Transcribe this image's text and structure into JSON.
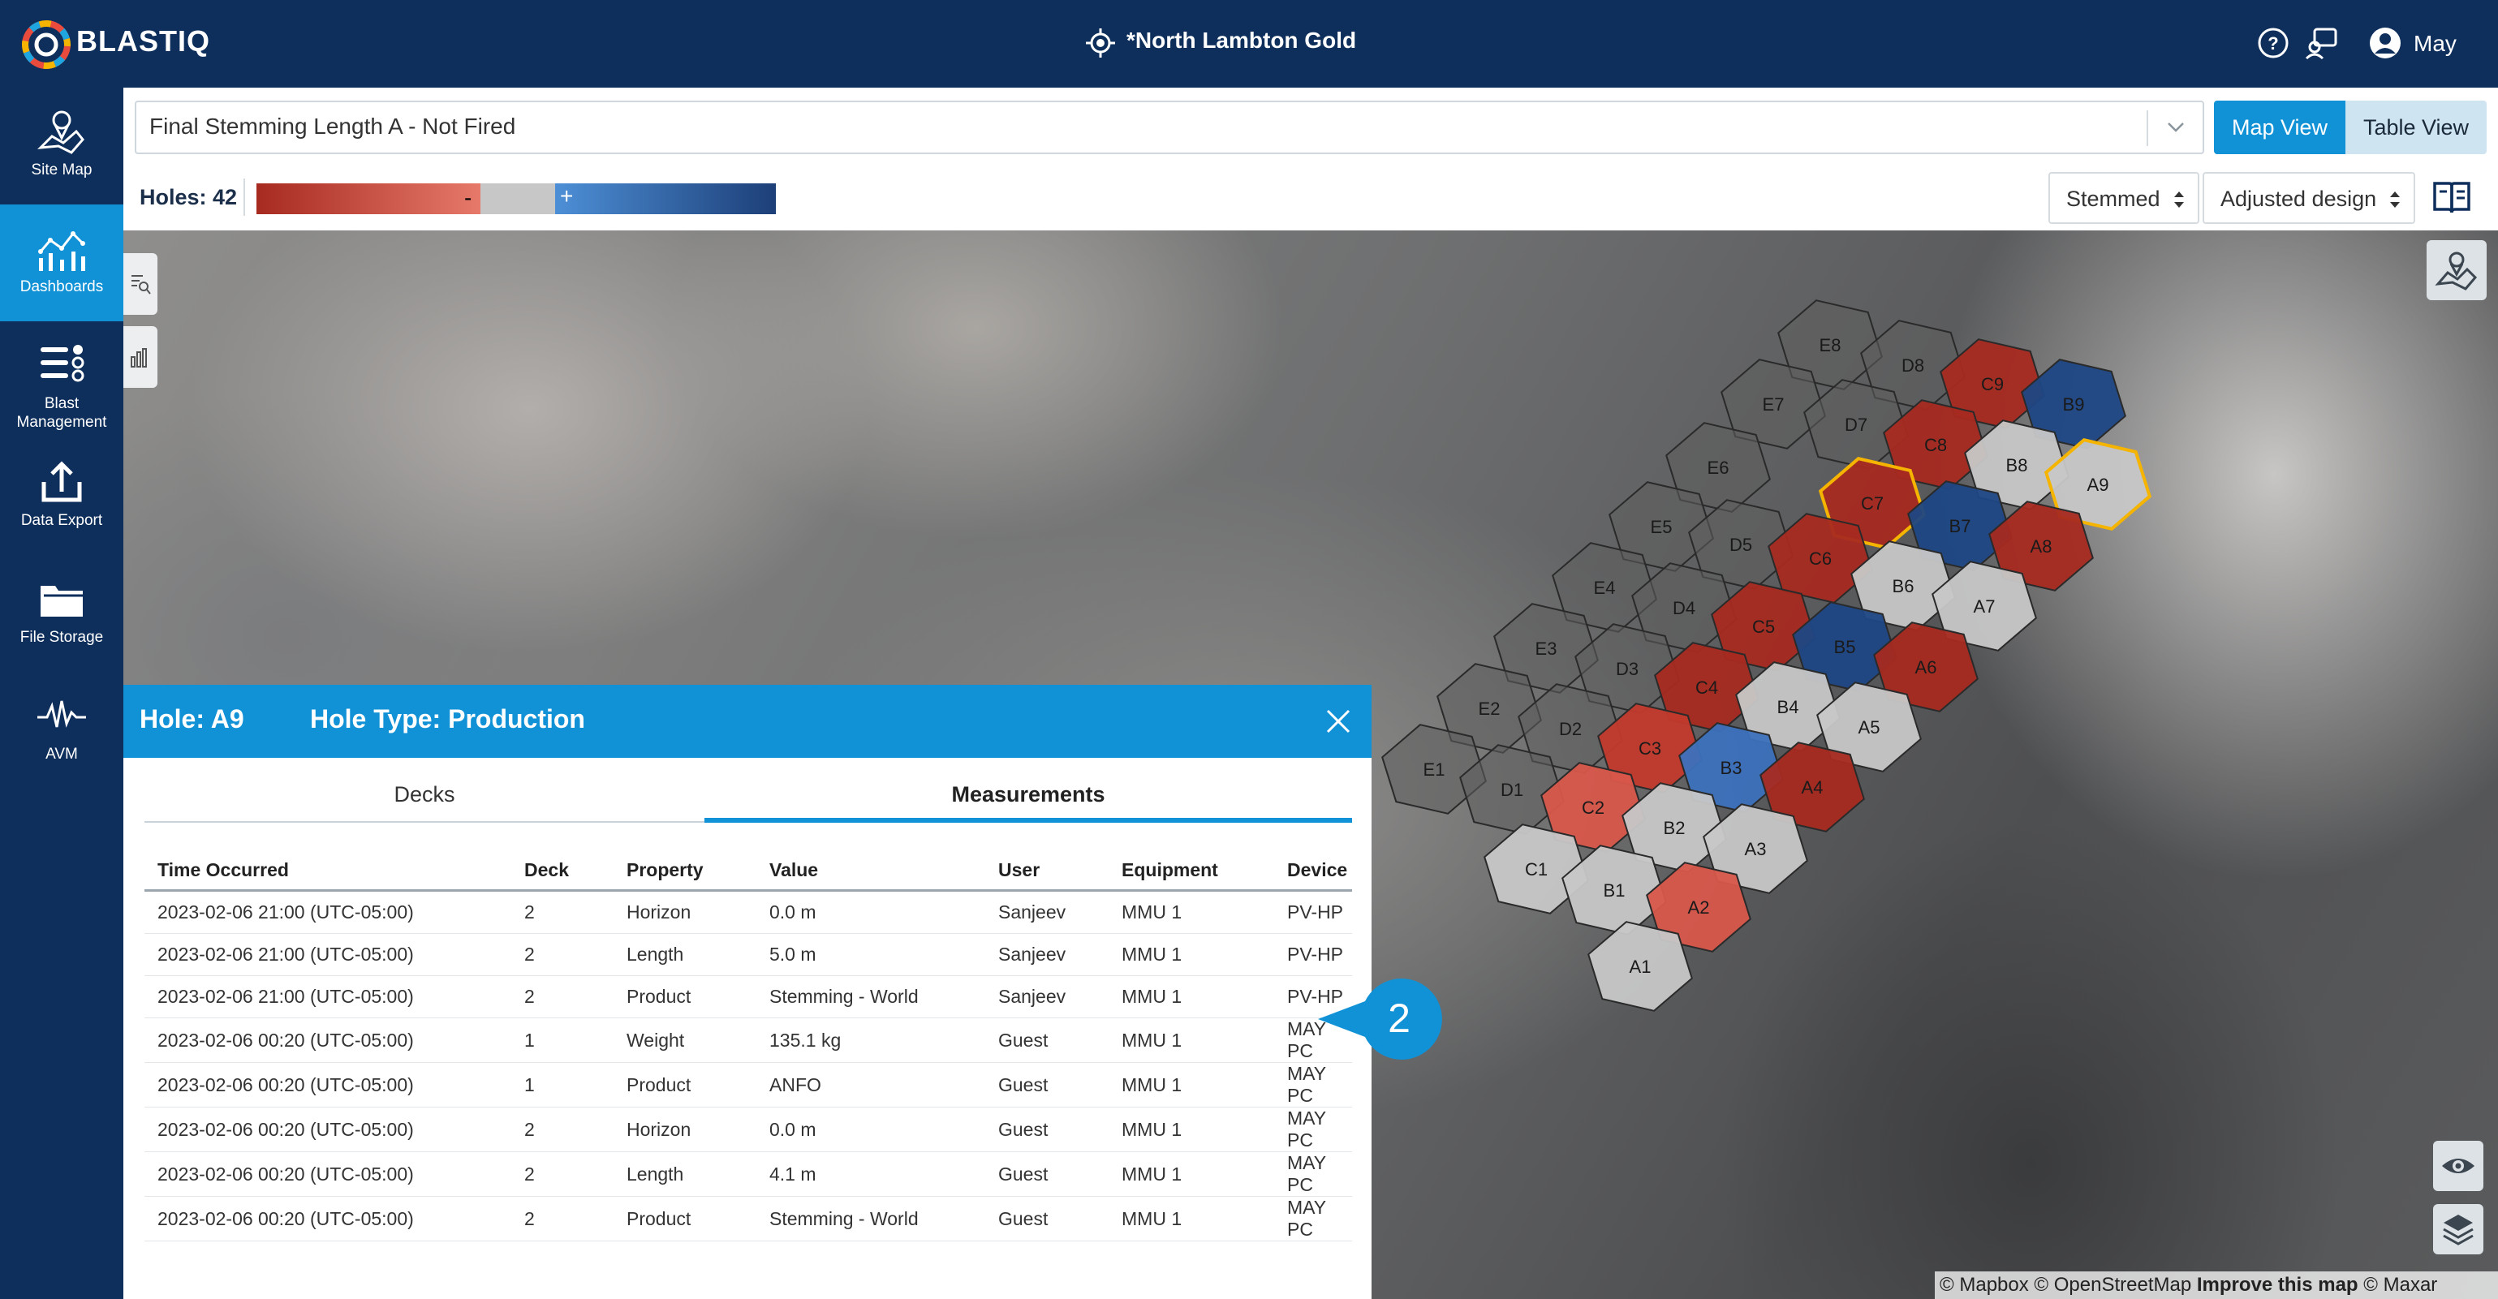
{
  "app": {
    "brand": "BLASTIQ",
    "site_name": "*North Lambton Gold",
    "user_name": "May"
  },
  "sidebar": {
    "items": [
      {
        "label": "Site Map",
        "icon": "site-map-icon"
      },
      {
        "label": "Dashboards",
        "icon": "dashboards-icon",
        "active": true
      },
      {
        "label": "Blast Management",
        "icon": "blast-management-icon"
      },
      {
        "label": "Data Export",
        "icon": "data-export-icon"
      },
      {
        "label": "File Storage",
        "icon": "file-storage-icon"
      },
      {
        "label": "AVM",
        "icon": "avm-icon"
      }
    ]
  },
  "toolbar": {
    "metric": "Final Stemming Length A - Not Fired",
    "view_map": "Map View",
    "view_table": "Table View",
    "active_view": "Map View",
    "holes_label": "Holes: 42",
    "legend_minus": "-",
    "legend_plus": "+",
    "filter_stemmed": "Stemmed",
    "filter_design": "Adjusted design"
  },
  "colors": {
    "navy": "#0e2f5c",
    "accent": "#1292d6",
    "dark_red": "#a72a20",
    "mid_red": "#c23a2c",
    "light_red": "#d9574b",
    "grey": "#c7c7c7",
    "light_blue": "#3c71bd",
    "dark_blue": "#1d4784",
    "unknown": "#5f5f5f",
    "selected_outline": "#f5b400"
  },
  "holes": [
    {
      "id": "E8",
      "cat": "unknown"
    },
    {
      "id": "D8",
      "cat": "unknown"
    },
    {
      "id": "C9",
      "cat": "dark_red"
    },
    {
      "id": "B9",
      "cat": "dark_blue"
    },
    {
      "id": "E7",
      "cat": "unknown"
    },
    {
      "id": "D7",
      "cat": "unknown"
    },
    {
      "id": "C8",
      "cat": "dark_red"
    },
    {
      "id": "B8",
      "cat": "grey"
    },
    {
      "id": "A9",
      "cat": "grey",
      "selected": true
    },
    {
      "id": "E6",
      "cat": "unknown"
    },
    {
      "id": "C7",
      "cat": "dark_red",
      "highlight": true
    },
    {
      "id": "B7",
      "cat": "dark_blue"
    },
    {
      "id": "A8",
      "cat": "dark_red"
    },
    {
      "id": "E5",
      "cat": "unknown"
    },
    {
      "id": "D5",
      "cat": "unknown"
    },
    {
      "id": "C6",
      "cat": "dark_red"
    },
    {
      "id": "B6",
      "cat": "grey"
    },
    {
      "id": "A7",
      "cat": "grey"
    },
    {
      "id": "E4",
      "cat": "unknown"
    },
    {
      "id": "D4",
      "cat": "unknown"
    },
    {
      "id": "C5",
      "cat": "dark_red"
    },
    {
      "id": "B5",
      "cat": "dark_blue"
    },
    {
      "id": "A6",
      "cat": "dark_red"
    },
    {
      "id": "E3",
      "cat": "unknown"
    },
    {
      "id": "D3",
      "cat": "unknown"
    },
    {
      "id": "C4",
      "cat": "dark_red"
    },
    {
      "id": "B4",
      "cat": "grey"
    },
    {
      "id": "A5",
      "cat": "grey"
    },
    {
      "id": "E2",
      "cat": "unknown"
    },
    {
      "id": "D2",
      "cat": "unknown"
    },
    {
      "id": "C3",
      "cat": "mid_red"
    },
    {
      "id": "B3",
      "cat": "light_blue"
    },
    {
      "id": "A4",
      "cat": "dark_red"
    },
    {
      "id": "E1",
      "cat": "unknown"
    },
    {
      "id": "D1",
      "cat": "unknown"
    },
    {
      "id": "C2",
      "cat": "light_red"
    },
    {
      "id": "B2",
      "cat": "grey"
    },
    {
      "id": "A3",
      "cat": "grey"
    },
    {
      "id": "C1",
      "cat": "grey"
    },
    {
      "id": "B1",
      "cat": "grey"
    },
    {
      "id": "A2",
      "cat": "light_red"
    },
    {
      "id": "A1",
      "cat": "grey"
    }
  ],
  "panel": {
    "hole_label": "Hole: A9",
    "hole_type_label": "Hole Type: Production",
    "tab_decks": "Decks",
    "tab_measurements": "Measurements",
    "active_tab": "Measurements",
    "columns": [
      "Time Occurred",
      "Deck",
      "Property",
      "Value",
      "User",
      "Equipment",
      "Device"
    ],
    "rows": [
      [
        "2023-02-06 21:00 (UTC-05:00)",
        "2",
        "Horizon",
        "0.0 m",
        "Sanjeev",
        "MMU 1",
        "PV-HP"
      ],
      [
        "2023-02-06 21:00 (UTC-05:00)",
        "2",
        "Length",
        "5.0 m",
        "Sanjeev",
        "MMU 1",
        "PV-HP"
      ],
      [
        "2023-02-06 21:00 (UTC-05:00)",
        "2",
        "Product",
        "Stemming - World",
        "Sanjeev",
        "MMU 1",
        "PV-HP"
      ],
      [
        "2023-02-06 00:20 (UTC-05:00)",
        "1",
        "Weight",
        "135.1 kg",
        "Guest",
        "MMU 1",
        "MAY PC"
      ],
      [
        "2023-02-06 00:20 (UTC-05:00)",
        "1",
        "Product",
        "ANFO",
        "Guest",
        "MMU 1",
        "MAY PC"
      ],
      [
        "2023-02-06 00:20 (UTC-05:00)",
        "2",
        "Horizon",
        "0.0 m",
        "Guest",
        "MMU 1",
        "MAY PC"
      ],
      [
        "2023-02-06 00:20 (UTC-05:00)",
        "2",
        "Length",
        "4.1 m",
        "Guest",
        "MMU 1",
        "MAY PC"
      ],
      [
        "2023-02-06 00:20 (UTC-05:00)",
        "2",
        "Product",
        "Stemming - World",
        "Guest",
        "MMU 1",
        "MAY PC"
      ]
    ]
  },
  "callout": {
    "number": "2"
  },
  "attribution": {
    "mapbox": "© Mapbox",
    "osm": "© OpenStreetMap",
    "improve": "Improve this map",
    "maxar": "© Maxar"
  }
}
